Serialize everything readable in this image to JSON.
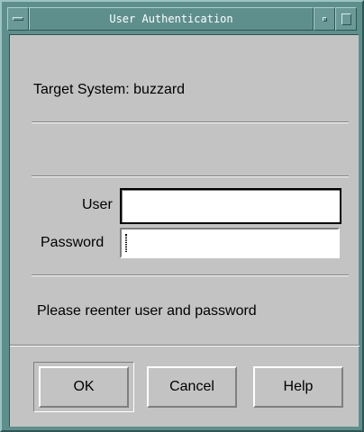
{
  "window": {
    "title": "User Authentication"
  },
  "dialog": {
    "target_system_label": "Target System: buzzard",
    "user_label": "User",
    "password_label": "Password",
    "user_value": "",
    "password_value": "",
    "message": "Please reenter user and password"
  },
  "buttons": {
    "ok": "OK",
    "cancel": "Cancel",
    "help": "Help"
  },
  "icons": {
    "window_menu": "window-menu-icon",
    "minimize": "minimize-icon",
    "maximize": "maximize-icon"
  },
  "colors": {
    "frame": "#5e8f8d",
    "client_background": "#c3c3c3",
    "field_background": "#ffffff",
    "title_text": "#ffffff"
  }
}
